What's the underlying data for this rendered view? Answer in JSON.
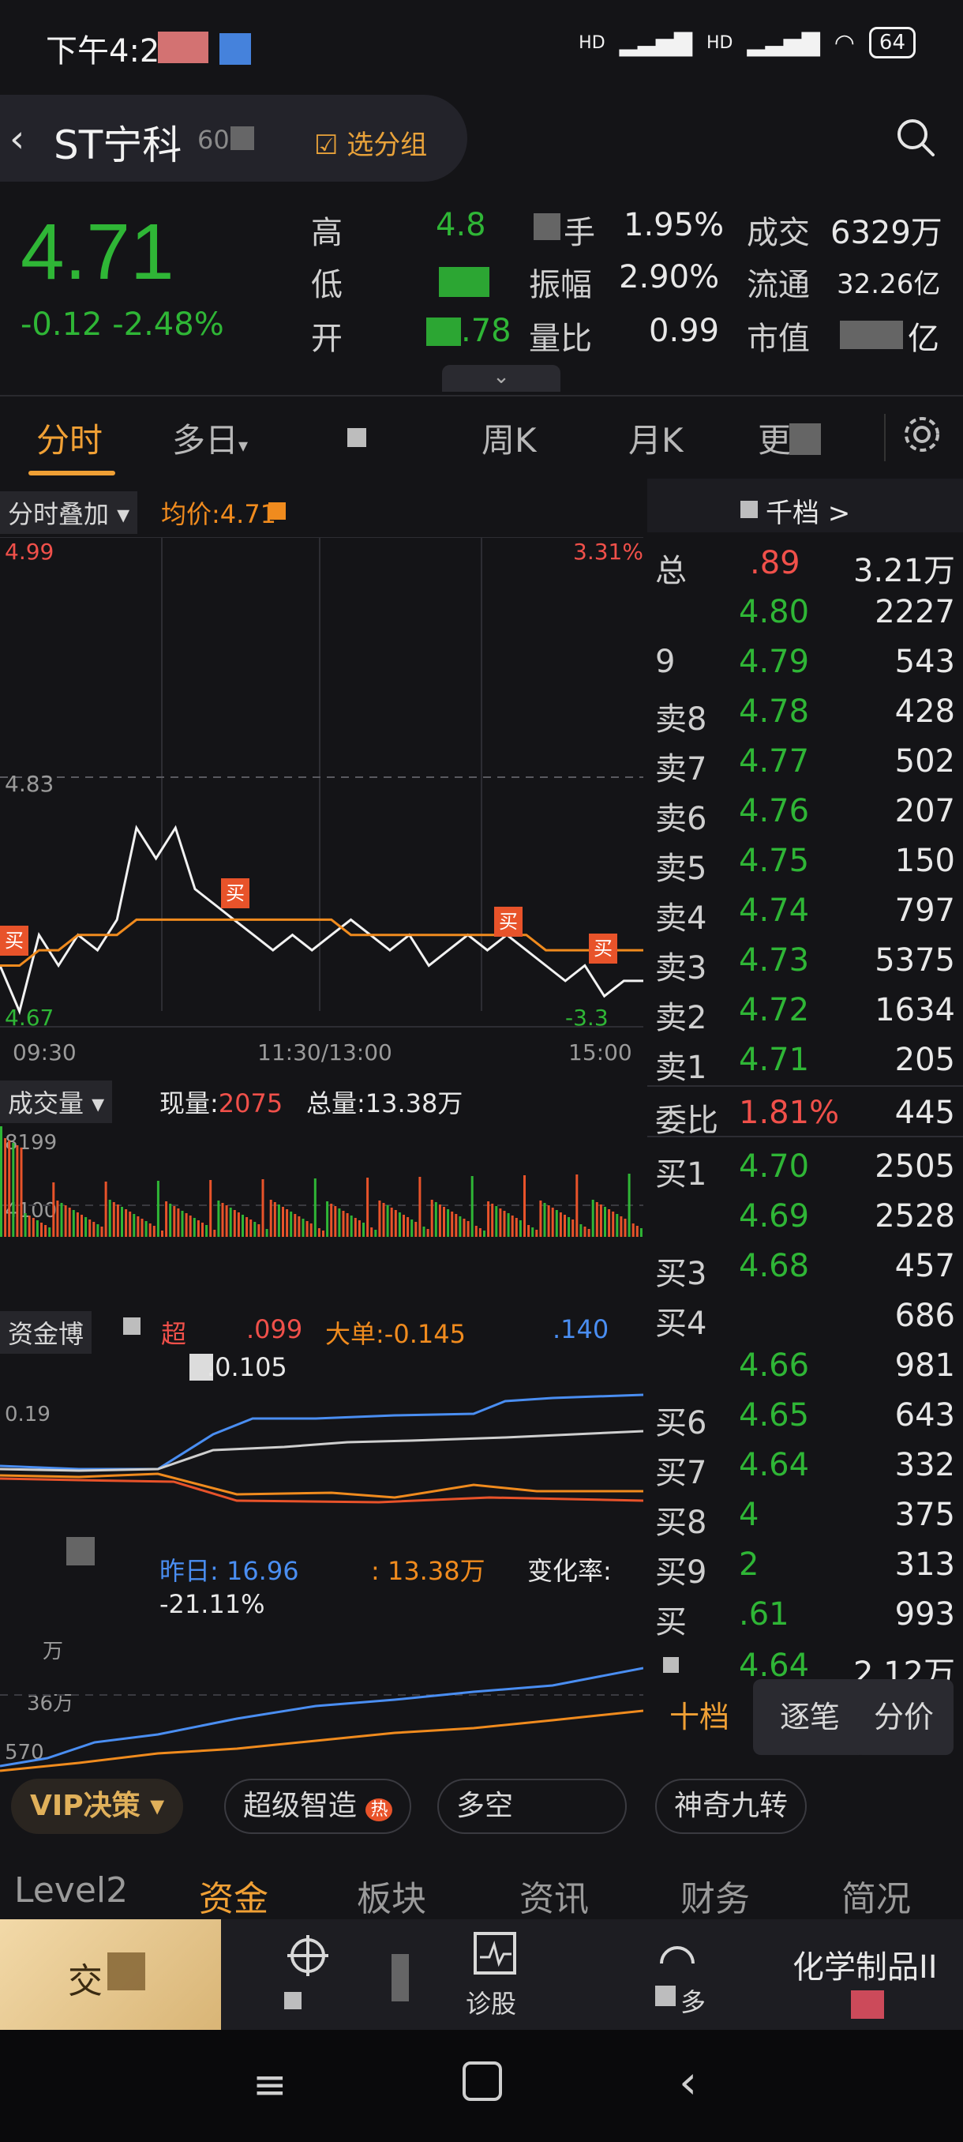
{
  "status_bar": {
    "time": "下午4:2",
    "signal_1": "HD",
    "signal_2": "HD",
    "battery": "64"
  },
  "header": {
    "stock_name": "ST宁科",
    "stock_code": "60",
    "select_group": "选分组"
  },
  "quote": {
    "price": "4.71",
    "change": "-0.12 -2.48%",
    "high_label": "高",
    "high": "4.8",
    "low_label": "低",
    "open_label": "开",
    "open": ".78",
    "turnover_label": "手",
    "turnover": "1.95%",
    "amplitude_label": "振幅",
    "amplitude": "2.90%",
    "volume_ratio_label": "量比",
    "volume_ratio": "0.99",
    "deal_label": "成交",
    "deal": "6329万",
    "float_label": "流通",
    "float": "32.26亿",
    "mktcap_label": "市值",
    "mktcap": "亿"
  },
  "tabs": [
    "分时",
    "多日",
    "周K",
    "月K"
  ],
  "tab_multi_suffix": "▾",
  "tab_more": "更",
  "chart": {
    "overlay_label": "分时叠加 ▾",
    "avg_price_label": "均价:4.71",
    "max_price": "4.99",
    "max_pct": "3.31%",
    "mid_price": "4.83",
    "min_price": "4.67",
    "min_pct": "-3.3",
    "time_start": "09:30",
    "time_mid": "11:30/13:00",
    "time_end": "15:00",
    "buy_marker": "买",
    "volume_label": "成交量 ▾",
    "current_vol_label": "现量:",
    "current_vol": "2075",
    "total_vol": "总量:13.38万",
    "vol_max": "8199",
    "vol_mid": "4100",
    "fund_label": "资金博",
    "fund_super": "超",
    "fund_super_val": ".099",
    "fund_big": "大单:-0.145",
    "fund_mid_val": ".140",
    "fund_small_val": ".0.105",
    "fund_tick": "0.19",
    "cmp_yesterday": "昨日: 16.96",
    "cmp_today": ": 13.38万",
    "cmp_change_label": "变化率:",
    "cmp_change": "-21.11%",
    "cmp_tick1": "万",
    "cmp_tick2": "36万",
    "cmp_tick3": "570"
  },
  "chart_data": {
    "type": "line",
    "x_ticks": [
      "09:30",
      "11:30/13:00",
      "15:00"
    ],
    "y_ticks": [
      "4.99",
      "4.83",
      "4.67"
    ],
    "series": [
      {
        "values": [
          4.71,
          4.68,
          4.73,
          4.71,
          4.73,
          4.72,
          4.74,
          4.8,
          4.78,
          4.8,
          4.76,
          4.75,
          4.74,
          4.73,
          4.72,
          4.73,
          4.72,
          4.73,
          4.74,
          4.73,
          4.72,
          4.73,
          4.71,
          4.72,
          4.73,
          4.72,
          4.73,
          4.72,
          4.71,
          4.7,
          4.71,
          4.69,
          4.7,
          4.7
        ]
      },
      {
        "values": [
          4.71,
          4.71,
          4.72,
          4.72,
          4.73,
          4.73,
          4.73,
          4.74,
          4.74,
          4.74,
          4.74,
          4.74,
          4.74,
          4.74,
          4.74,
          4.74,
          4.74,
          4.74,
          4.73,
          4.73,
          4.73,
          4.73,
          4.73,
          4.73,
          4.73,
          4.73,
          4.73,
          4.73,
          4.72,
          4.72,
          4.72,
          4.72,
          4.72,
          4.72
        ]
      }
    ],
    "ylim": [
      4.67,
      4.99
    ]
  },
  "orderbook": {
    "header": "千档 >",
    "total_label": "总",
    "total_price": ".89",
    "total_vol": "3.21万",
    "asks": [
      {
        "label": "",
        "price": "4.80",
        "vol": "2227"
      },
      {
        "label": "9",
        "price": "4.79",
        "vol": "543"
      },
      {
        "label": "卖8",
        "price": "4.78",
        "vol": "428"
      },
      {
        "label": "卖7",
        "price": "4.77",
        "vol": "502"
      },
      {
        "label": "卖6",
        "price": "4.76",
        "vol": "207"
      },
      {
        "label": "卖5",
        "price": "4.75",
        "vol": "150"
      },
      {
        "label": "卖4",
        "price": "4.74",
        "vol": "797"
      },
      {
        "label": "卖3",
        "price": "4.73",
        "vol": "5375"
      },
      {
        "label": "卖2",
        "price": "4.72",
        "vol": "1634"
      },
      {
        "label": "卖1",
        "price": "4.71",
        "vol": "205"
      }
    ],
    "ratio_label": "委比",
    "ratio": "1.81%",
    "ratio_vol": "445",
    "bids": [
      {
        "label": "买1",
        "price": "4.70",
        "vol": "2505"
      },
      {
        "label": "",
        "price": "4.69",
        "vol": "2528"
      },
      {
        "label": "买3",
        "price": "4.68",
        "vol": "457"
      },
      {
        "label": "买4",
        "price": "",
        "vol": "686"
      },
      {
        "label": "",
        "price": "4.66",
        "vol": "981"
      },
      {
        "label": "买6",
        "price": "4.65",
        "vol": "643"
      },
      {
        "label": "买7",
        "price": "4.64",
        "vol": "332"
      },
      {
        "label": "买8",
        "price": "4",
        "vol": "375"
      },
      {
        "label": "买9",
        "price": "2",
        "vol": "313"
      },
      {
        "label": "买",
        "price": ".61",
        "vol": "993"
      }
    ],
    "summary_price": "4.64",
    "summary_vol": "2.12万",
    "btn_ten": "十档",
    "btn_tick": "逐笔",
    "btn_split": "分价"
  },
  "chips": {
    "vip": "VIP决策 ▾",
    "super": "超级智造",
    "hot": "热",
    "longshort": "多空",
    "magic": "神奇九转"
  },
  "section_tabs": [
    "Level2",
    "资金",
    "板块",
    "资讯",
    "财务",
    "简况"
  ],
  "bottom_bar": {
    "trade": "交",
    "diagnose": "诊股",
    "more": "多",
    "industry": "化学制品II"
  }
}
